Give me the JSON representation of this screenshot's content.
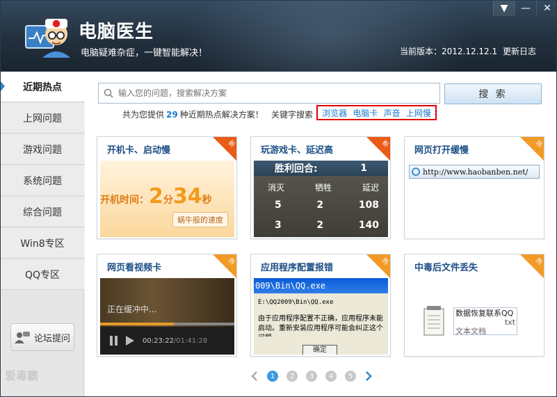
{
  "header": {
    "title": "电脑医生",
    "slogan": "电脑疑难杂症，一键智能解决！",
    "version_label": "当前版本：2012.12.12.1",
    "changelog": "更新日志"
  },
  "window_controls": {
    "menu": "▼",
    "minimize": "—",
    "close": "✕"
  },
  "sidebar": {
    "items": [
      {
        "label": "近期热点"
      },
      {
        "label": "上网问题"
      },
      {
        "label": "游戏问题"
      },
      {
        "label": "系统问题"
      },
      {
        "label": "综合问题"
      },
      {
        "label": "Win8专区"
      },
      {
        "label": "QQ专区"
      }
    ],
    "forum_button": "论坛提问"
  },
  "search": {
    "placeholder": "输入您的问题，搜索解决方案",
    "button": "搜 索"
  },
  "hint": {
    "prefix": "共为您提供",
    "count": "29",
    "suffix": "种近期热点解决方案！",
    "keywords_label": "关键字搜索",
    "keywords": [
      "浏览器",
      "电脑卡",
      "声音",
      "上网慢"
    ]
  },
  "cards": [
    {
      "title": "开机卡、启动慢",
      "badge": "新",
      "thumb": {
        "line1": "开机时间：",
        "digit1": "2",
        "unit1": "分",
        "digit2": "34",
        "unit2": "秒",
        "caption": "蜗牛般的速度"
      }
    },
    {
      "title": "玩游戏卡、延迟高",
      "badge": "新",
      "thumb": {
        "head_label": "胜利回合:",
        "head_value": "1",
        "cols": [
          "消灭",
          "牺牲",
          "延迟"
        ],
        "rows": [
          [
            "5",
            "2",
            "108"
          ],
          [
            "3",
            "2",
            "140"
          ]
        ]
      }
    },
    {
      "title": "网页打开缓慢",
      "badge": "热",
      "thumb": {
        "url": "http://www.haobanben.net/"
      }
    },
    {
      "title": "网页看视频卡",
      "badge": "热",
      "thumb": {
        "buffering": "正在缓冲中...",
        "time_now": "00:23:22",
        "time_total": "/01:41:28"
      }
    },
    {
      "title": "应用程序配置报错",
      "badge": "热",
      "thumb": {
        "titlebar": "009\\Bin\\QQ.exe",
        "path": "E:\\QQ2009\\Bin\\QQ.exe",
        "msg": "由于应用程序配置不正确，应用程序未能启动。重新安装应用程序可能会纠正这个问题。",
        "ok": "确定"
      }
    },
    {
      "title": "中毒后文件丢失",
      "badge": "热",
      "thumb": {
        "file1": "数据恢复联系QQ",
        "file2": "txt",
        "file3": "文本文档"
      }
    }
  ],
  "pager": {
    "pages": [
      "1",
      "2",
      "3",
      "4",
      "5"
    ],
    "current": "1"
  },
  "watermark": "爱毒霸"
}
